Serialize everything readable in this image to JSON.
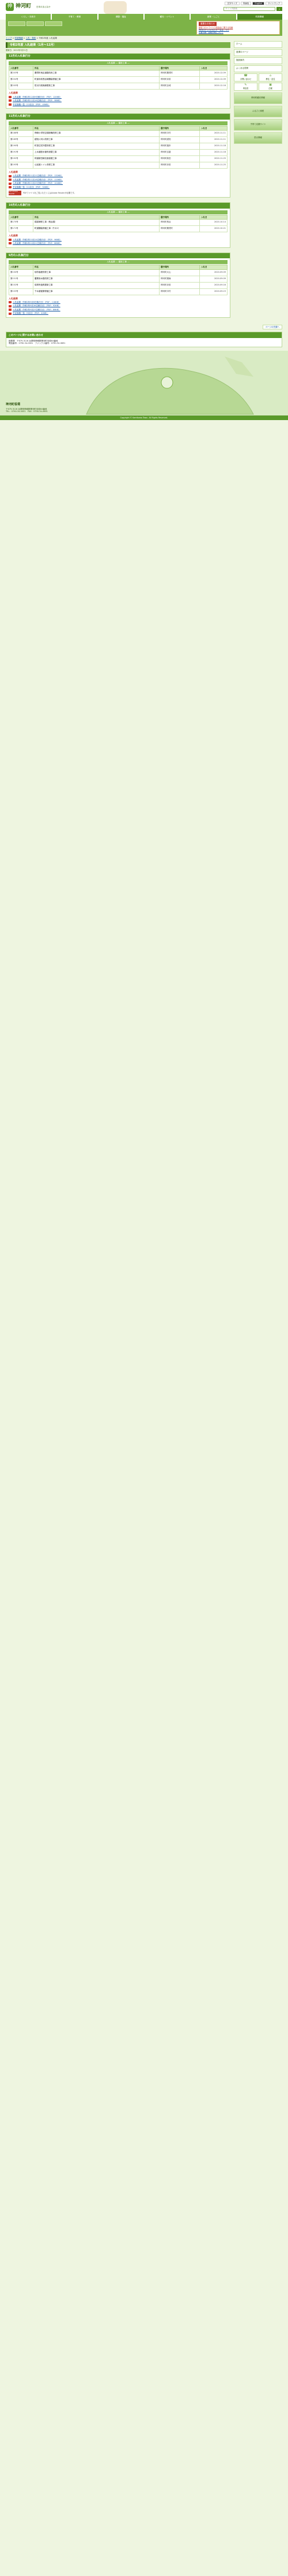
{
  "header": {
    "logo_char": "神",
    "logo_text": "神河町",
    "logo_sub": "Kamikawa Town",
    "tagline": "日本のまんなか",
    "buttons": [
      "文字サイズ",
      "背景色",
      "English",
      "サイトマップ"
    ],
    "search_placeholder": "サイト内検索",
    "search_label": "検索"
  },
  "nav": [
    "くらし・手続き",
    "子育て・教育",
    "健康・福祉",
    "観光・イベント",
    "産業・しごと",
    "町政情報"
  ],
  "notice": {
    "title": "重要なお知らせ",
    "lines": [
      "新型コロナウイルス感染症に関する情報",
      "神河町からのお知らせ一覧はこちら",
      "災害情報・避難情報について"
    ]
  },
  "breadcrumb": [
    "トップ",
    "町政情報",
    "入札・契約",
    "令和2年度 入札結果"
  ],
  "page_title": "令和2年度 入札結果（1月～12月）",
  "updated_label": "更新日：",
  "updated_value": "2021年3月31日",
  "table_headers": [
    "入札番号",
    "件名",
    "履行場所",
    "入札日"
  ],
  "sub_bar_label": "入札結果 ― 建設工事 ―",
  "pdf_heading": "入札結果",
  "months": [
    {
      "label": "12月の入札執行分",
      "rows": [
        {
          "num": "第203号",
          "title": "粟賀町地区道路改良工事",
          "place": "神河町粟賀町",
          "date": "2020.12.09"
        },
        {
          "num": "第204号",
          "title": "町道寺前長谷線舗装修繕工事",
          "place": "神河町寺前",
          "date": "2020.12.09"
        },
        {
          "num": "第205号",
          "title": "防災行政無線更新工事",
          "place": "神河町全域",
          "date": "2020.12.16"
        }
      ],
      "pdfs": [
        "入札結果（令和2年12月9日執行分）（PDF：120KB）",
        "入札結果（令和2年12月16日執行分）（PDF：98KB）",
        "予定価格一覧（12月分）（PDF：45KB）"
      ]
    },
    {
      "label": "11月の入札執行分",
      "rows": [
        {
          "num": "第188号",
          "title": "神崎小学校空調設備改修工事",
          "place": "神河町中村",
          "date": "2020.11.11"
        },
        {
          "num": "第189号",
          "title": "越知川河川改修工事",
          "place": "神河町越知",
          "date": "2020.11.11"
        },
        {
          "num": "第190号",
          "title": "町営住宅外壁改修工事",
          "place": "神河町福本",
          "date": "2020.11.18"
        },
        {
          "num": "第191号",
          "title": "上水道配水管布設替工事",
          "place": "神河町吉冨",
          "date": "2020.11.18"
        },
        {
          "num": "第192号",
          "title": "林道新田線法面保護工事",
          "place": "神河町新田",
          "date": "2020.11.25"
        },
        {
          "num": "第193号",
          "title": "公民館トイレ改修工事",
          "place": "神河町寺前",
          "date": "2020.11.25"
        }
      ],
      "pdfs": [
        "入札結果（令和2年11月11日執行分）（PDF：132KB）",
        "入札結果（令和2年11月18日執行分）（PDF：110KB）",
        "入札結果（令和2年11月25日執行分）（PDF：104KB）",
        "予定価格一覧（11月分）（PDF：52KB）"
      ]
    },
    {
      "label": "10月の入札執行分",
      "rows": [
        {
          "num": "第170号",
          "title": "橋梁補修工事（長谷橋）",
          "place": "神河町長谷",
          "date": "2020.10.14"
        },
        {
          "num": "第171号",
          "title": "町道舗装修繕工事（その2）",
          "place": "神河町粟賀町",
          "date": "2020.10.21"
        }
      ],
      "pdfs": [
        "入札結果（令和2年10月14日執行分）（PDF：96KB）",
        "入札結果（令和2年10月21日執行分）（PDF：88KB）"
      ]
    },
    {
      "label": "9月の入札執行分",
      "rows": [
        {
          "num": "第150号",
          "title": "砂防堰堤改修工事",
          "place": "神河町大山",
          "date": "2020.09.09"
        },
        {
          "num": "第151号",
          "title": "農業用水路改修工事",
          "place": "神河町猪篠",
          "date": "2020.09.09"
        },
        {
          "num": "第152号",
          "title": "保育所遊具更新工事",
          "place": "神河町寺前",
          "date": "2020.09.16"
        },
        {
          "num": "第153号",
          "title": "下水道管渠修繕工事",
          "place": "神河町中村",
          "date": "2020.09.23"
        }
      ],
      "pdfs": [
        "入札結果（令和2年9月9日執行分）（PDF：118KB）",
        "入札結果（令和2年9月16日執行分）（PDF：92KB）",
        "入札結果（令和2年9月23日執行分）（PDF：86KB）",
        "予定価格一覧（9月分）（PDF：40KB）"
      ]
    }
  ],
  "reader_text": "PDFファイルをご覧いただくにはAdobe Readerが必要です。",
  "reader_badge": "Get Adobe Reader",
  "side": {
    "buttons": [
      "ホーム",
      "各課のページ",
      "施設案内",
      "よくある質問"
    ],
    "tiles": [
      {
        "icon": "☎",
        "label": "お問い合わせ"
      },
      {
        "icon": "⌂",
        "label": "移住・定住"
      },
      {
        "icon": "✎",
        "label": "申請書"
      },
      {
        "icon": "▣",
        "label": "広報"
      }
    ],
    "banners": [
      "神河町観光情報",
      "ふるさと納税",
      "子育て応援サイト",
      "防災情報"
    ]
  },
  "page_top_label": "ページの先頭へ",
  "inquiry": {
    "head": "このページに関するお問い合わせ",
    "line1": "総務課　〒679-3116 兵庫県神崎郡神河町寺前64番地",
    "line2": "電話番号：0790-34-0001　ファックス番号：0790-34-0691"
  },
  "footer": {
    "name": "神河町役場",
    "address": "〒679-3116 兵庫県神崎郡神河町寺前64番地",
    "tel": "TEL：0790-34-0001　FAX：0790-34-0691",
    "copyright": "Copyright © Kamikawa Town. All Rights Reserved."
  }
}
